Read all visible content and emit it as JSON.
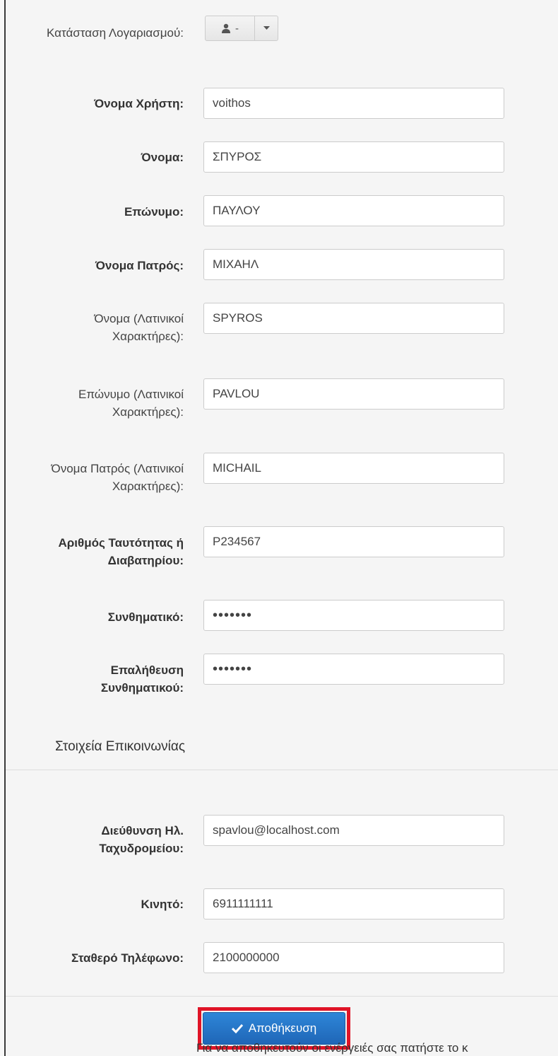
{
  "form": {
    "account_status_label": "Κατάσταση Λογαριασμού:",
    "account_status_value": "-",
    "fields": [
      {
        "label": "Όνομα Χρήστη:",
        "value": "voithos"
      },
      {
        "label": "Όνομα:",
        "value": "ΣΠΥΡΟΣ"
      },
      {
        "label": "Επώνυμο:",
        "value": "ΠΑΥΛΟΥ"
      },
      {
        "label": "Όνομα Πατρός:",
        "value": "ΜΙΧΑΗΛ"
      },
      {
        "label": "Όνομα (Λατινικοί Χαρακτήρες):",
        "value": "SPYROS"
      },
      {
        "label": "Επώνυμο (Λατινικοί Χαρακτήρες):",
        "value": "PAVLOU"
      },
      {
        "label": "Όνομα Πατρός (Λατινικοί Χαρακτήρες):",
        "value": "MICHAIL"
      },
      {
        "label": "Αριθμός Ταυτότητας ή Διαβατηρίου:",
        "value": "P234567"
      },
      {
        "label": "Συνθηματικό:",
        "value": "•••••••"
      },
      {
        "label": "Επαλήθευση Συνθηματικού:",
        "value": "•••••••"
      }
    ],
    "contact_section_title": "Στοιχεία Επικοινωνίας",
    "contact_fields": [
      {
        "label": "Διεύθυνση Ηλ. Ταχυδρομείου:",
        "value": "spavlou@localhost.com"
      },
      {
        "label": "Κινητό:",
        "value": "6911111111"
      },
      {
        "label": "Σταθερό Τηλέφωνο:",
        "value": "2100000000"
      }
    ],
    "save_label": "Αποθήκευση",
    "footer_text": "Για να αποθηκευτούν οι ενέργειές σας πατήστε το κ"
  }
}
